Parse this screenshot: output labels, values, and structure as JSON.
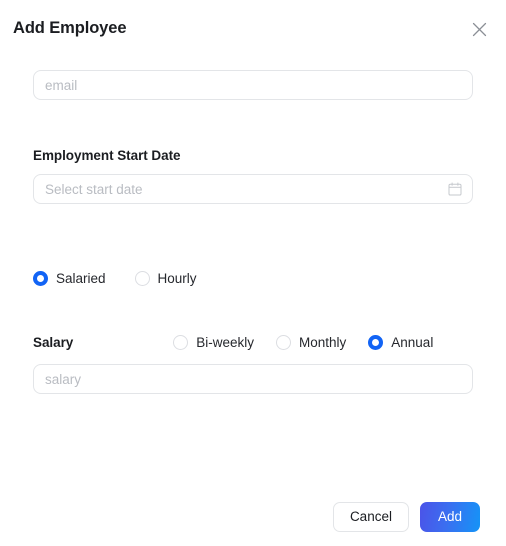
{
  "dialog": {
    "title": "Add Employee",
    "close_icon": "close-icon"
  },
  "fields": {
    "email": {
      "placeholder": "email",
      "value": ""
    },
    "start_date": {
      "label": "Employment Start Date",
      "placeholder": "Select start date",
      "value": "",
      "icon": "calendar-icon"
    },
    "salary": {
      "label": "Salary",
      "placeholder": "salary",
      "value": ""
    }
  },
  "employment_type": {
    "options": [
      {
        "label": "Salaried",
        "selected": true
      },
      {
        "label": "Hourly",
        "selected": false
      }
    ]
  },
  "salary_frequency": {
    "options": [
      {
        "label": "Bi-weekly",
        "selected": false
      },
      {
        "label": "Monthly",
        "selected": false
      },
      {
        "label": "Annual",
        "selected": true
      }
    ]
  },
  "footer": {
    "cancel_label": "Cancel",
    "add_label": "Add"
  },
  "colors": {
    "accent": "#1264f5",
    "primary_gradient_start": "#4b53e8",
    "primary_gradient_end": "#1494f7",
    "text": "#1b1d21",
    "placeholder": "#b9bcc2",
    "border": "#e3e5e8"
  }
}
